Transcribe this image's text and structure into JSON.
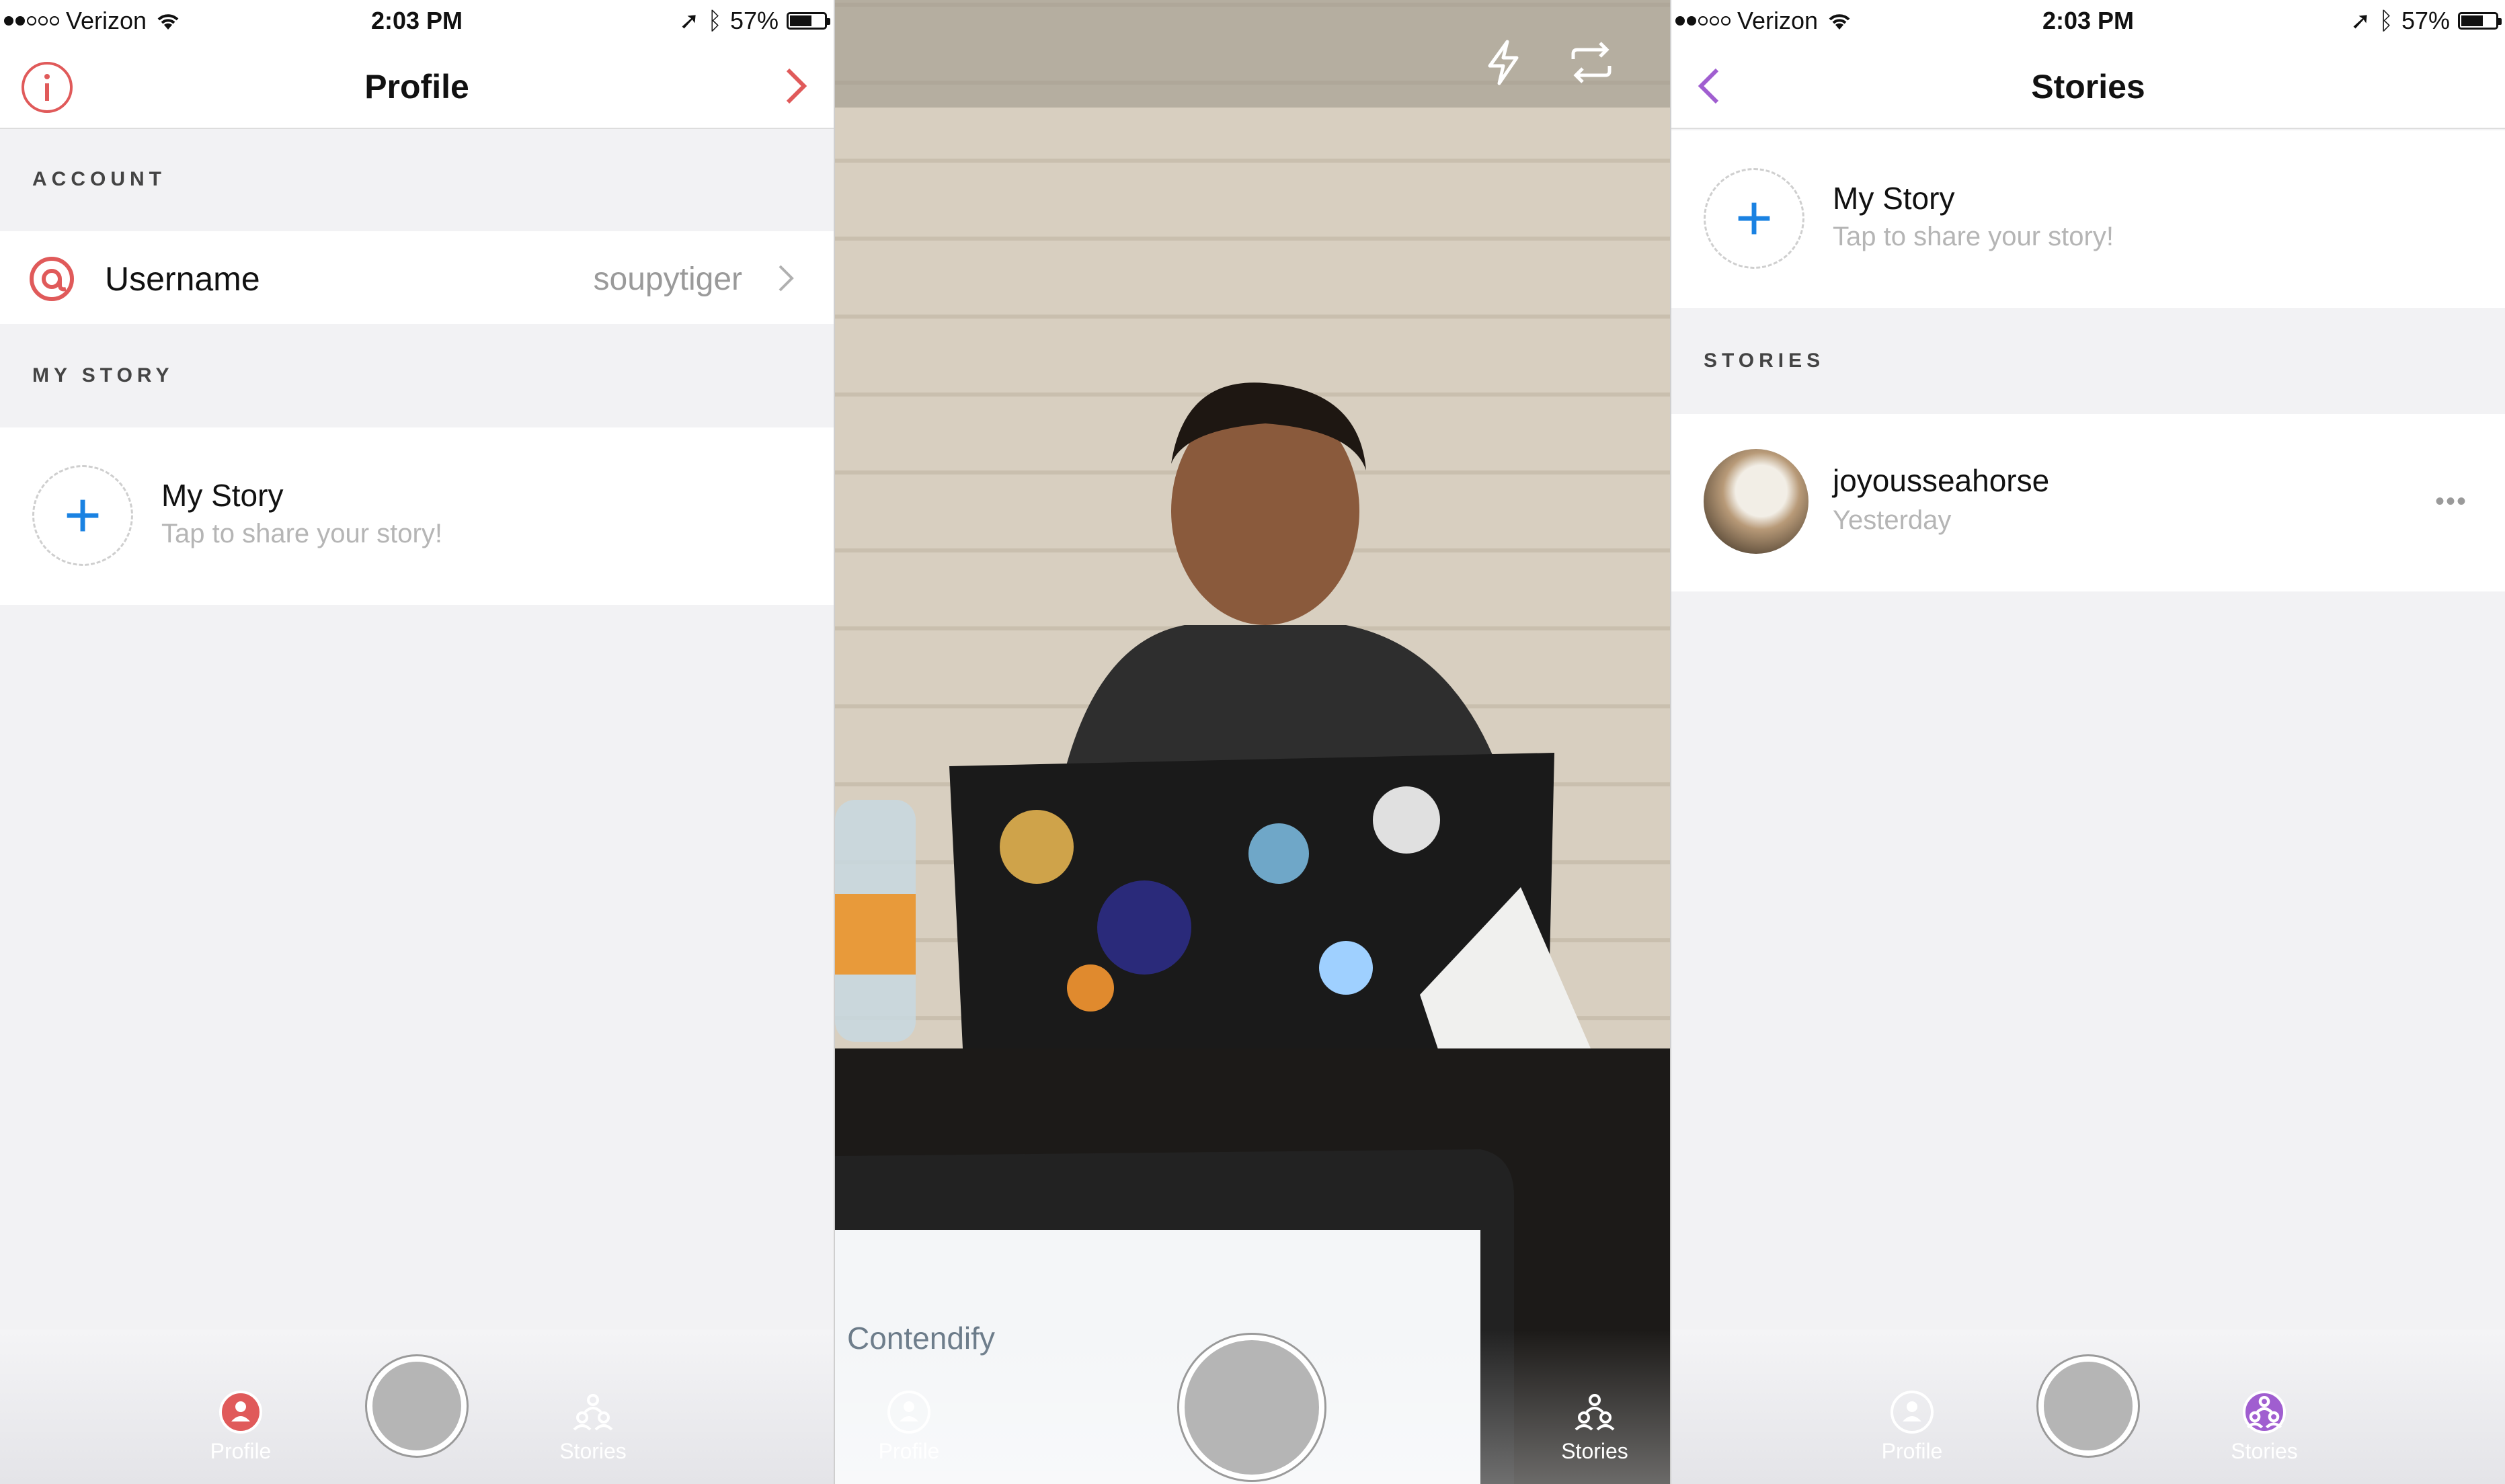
{
  "status": {
    "carrier": "Verizon",
    "time": "2:03 PM",
    "battery": "57%"
  },
  "profile_screen": {
    "title": "Profile",
    "account_header": "ACCOUNT",
    "username_label": "Username",
    "username_value": "soupytiger",
    "my_story_header": "MY STORY",
    "my_story_title": "My Story",
    "my_story_sub": "Tap to share your story!"
  },
  "camera_screen": {
    "laptop_text": "Contendify"
  },
  "stories_screen": {
    "title": "Stories",
    "my_story_title": "My Story",
    "my_story_sub": "Tap to share your story!",
    "stories_header": "STORIES",
    "stories": [
      {
        "name": "joyousseahorse",
        "time": "Yesterday"
      }
    ]
  },
  "tabs": {
    "profile": "Profile",
    "stories": "Stories"
  },
  "colors": {
    "profile_accent": "#e05a5a",
    "stories_accent": "#a05ed0",
    "plus_blue": "#1a82e2"
  }
}
